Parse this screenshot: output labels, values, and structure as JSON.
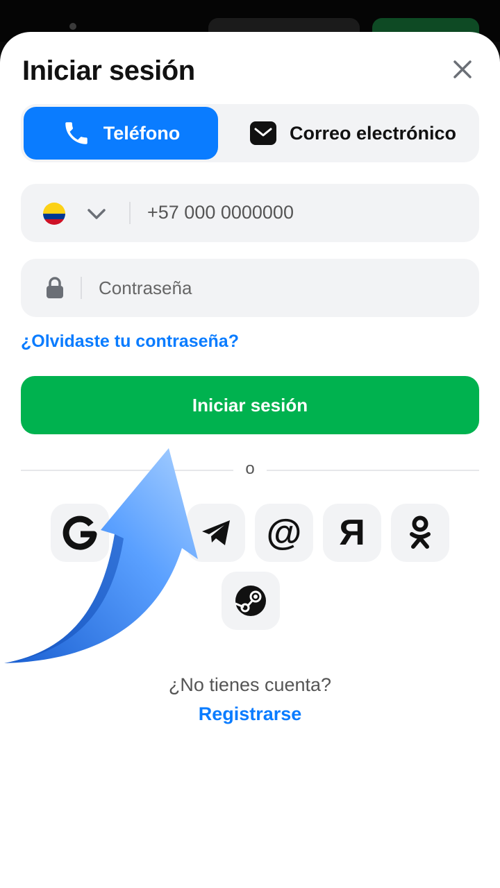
{
  "header": {
    "title": "Iniciar sesión"
  },
  "tabs": [
    {
      "label": "Teléfono",
      "icon": "phone-icon",
      "active": true
    },
    {
      "label": "Correo electrónico",
      "icon": "envelope-icon",
      "active": false
    }
  ],
  "phone_field": {
    "country_flag": "colombia-flag-icon",
    "placeholder": "+57 000 0000000"
  },
  "password_field": {
    "placeholder": "Contraseña"
  },
  "forgot_link": "¿Olvidaste tu contraseña?",
  "login_button": "Iniciar sesión",
  "divider_text": "o",
  "social_providers": [
    "google-icon",
    "telegram-icon",
    "mail-at-icon",
    "yandex-icon",
    "odnoklassniki-icon",
    "steam-icon"
  ],
  "footer": {
    "question": "¿No tienes cuenta?",
    "register": "Registrarse"
  },
  "colors": {
    "primary_blue": "#0a7cff",
    "primary_green": "#00b24f",
    "field_bg": "#f2f3f5"
  }
}
